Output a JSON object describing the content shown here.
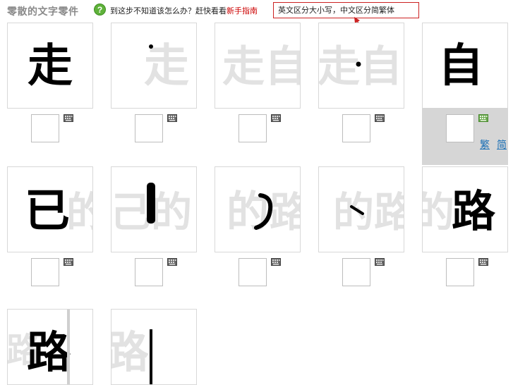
{
  "header": {
    "title": "零散的文字零件",
    "help_icon_glyph": "?",
    "help_prefix": "到这步不知道该怎么办？赶快看看",
    "help_link": "新手指南",
    "tooltip": "英文区分大小写，中文区分简繁体"
  },
  "tiles": [
    {
      "char": "走",
      "ghost_right": "走"
    },
    {
      "char": "",
      "ghost_right": "走"
    },
    {
      "char": "",
      "ghost_right": "走自"
    },
    {
      "char": "",
      "ghost_right": "走自"
    },
    {
      "char": "自",
      "ghost_right": ""
    },
    {
      "char": "已",
      "ghost_right": "的"
    },
    {
      "char": "的",
      "ghost_right": "己的"
    },
    {
      "char": "的",
      "ghost_right": "路"
    },
    {
      "char": "",
      "ghost_right": "的路"
    },
    {
      "char": "路",
      "ghost_right": "的"
    },
    {
      "char": "路",
      "ghost_right": ""
    },
    {
      "char": "",
      "ghost_right": "路"
    }
  ],
  "selected_panel": {
    "traditional_label": "繁",
    "simplified_label": "简"
  },
  "colors": {
    "help_icon": "#5fb23a",
    "link_red": "#cc0000",
    "tooltip_border": "#cc2222",
    "selected_bg": "#d6d6d6",
    "trad_simp_link": "#1a6fb5"
  }
}
